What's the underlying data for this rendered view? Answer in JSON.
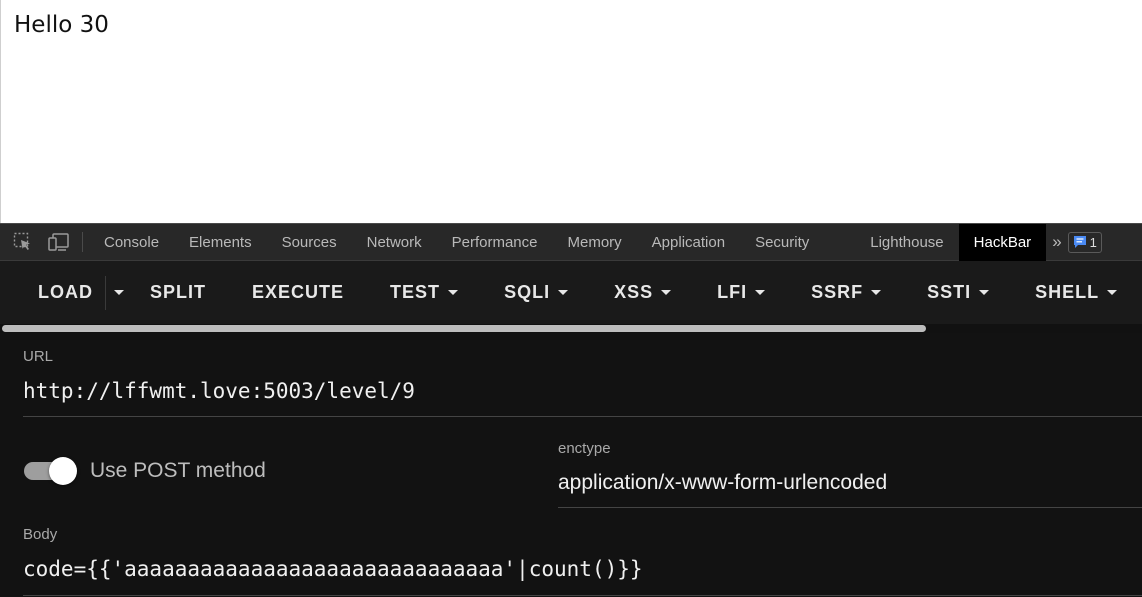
{
  "page": {
    "text": "Hello 30"
  },
  "devtools": {
    "tabs": [
      "Console",
      "Elements",
      "Sources",
      "Network",
      "Performance",
      "Memory",
      "Application",
      "Security",
      "Lighthouse",
      "HackBar"
    ],
    "active_tab": "HackBar",
    "more_tabs": "»",
    "issues_count": "1"
  },
  "hackbar": {
    "toolbar": {
      "load": "LOAD",
      "split": "SPLIT",
      "execute": "EXECUTE",
      "test": "TEST",
      "sqli": "SQLI",
      "xss": "XSS",
      "lfi": "LFI",
      "ssrf": "SSRF",
      "ssti": "SSTI",
      "shell": "SHELL"
    },
    "url": {
      "label": "URL",
      "value": "http://lffwmt.love:5003/level/9"
    },
    "post": {
      "label": "Use POST method",
      "enabled": true
    },
    "enctype": {
      "label": "enctype",
      "value": "application/x-www-form-urlencoded"
    },
    "body": {
      "label": "Body",
      "value": "code={{'aaaaaaaaaaaaaaaaaaaaaaaaaaaaaa'|count()}}"
    }
  },
  "colors": {
    "accent_toggle": "#9e9e9e",
    "panel_bg": "#121212",
    "toolbar_bg": "#1a1a1a"
  }
}
